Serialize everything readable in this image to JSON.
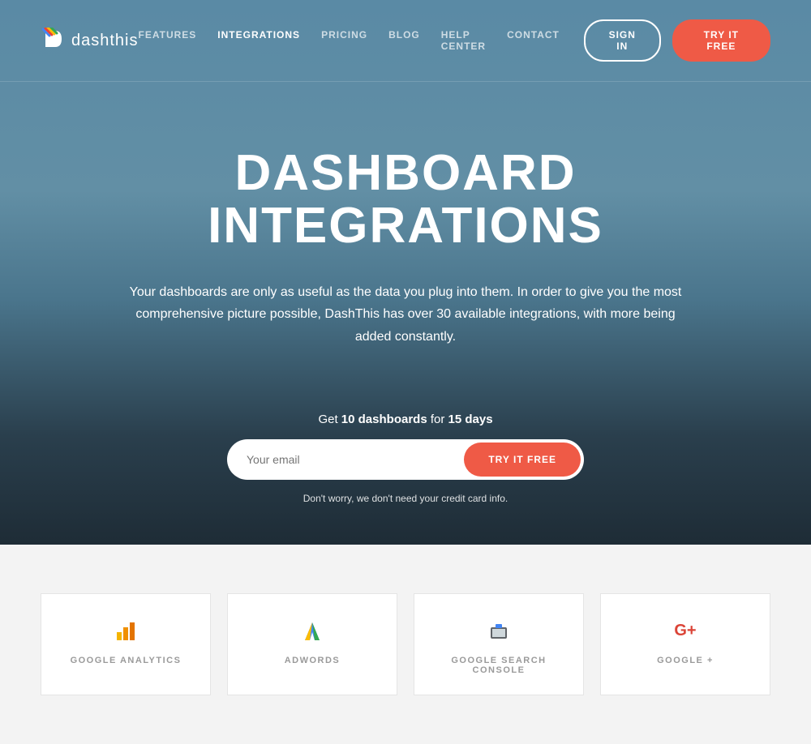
{
  "brand": {
    "name": "dashthis"
  },
  "nav": {
    "items": [
      {
        "label": "FEATURES",
        "active": false
      },
      {
        "label": "INTEGRATIONS",
        "active": true
      },
      {
        "label": "PRICING",
        "active": false
      },
      {
        "label": "BLOG",
        "active": false
      },
      {
        "label": "HELP CENTER",
        "active": false
      },
      {
        "label": "CONTACT",
        "active": false
      }
    ]
  },
  "header": {
    "signin_label": "SIGN IN",
    "try_label": "TRY IT FREE"
  },
  "hero": {
    "title_line1": "DASHBOARD",
    "title_line2": "INTEGRATIONS",
    "description": "Your dashboards are only as useful as the data you plug into them. In order to give you the most comprehensive picture possible, DashThis has over 30 available integrations, with more being added constantly."
  },
  "cta": {
    "tag_prefix": "Get ",
    "tag_bold1": "10 dashboards",
    "tag_mid": " for ",
    "tag_bold2": "15 days",
    "email_placeholder": "Your email",
    "button_label": "TRY IT FREE",
    "note": "Don't worry, we don't need your credit card info."
  },
  "integrations": {
    "cards": [
      {
        "name": "GOOGLE ANALYTICS",
        "icon": "google-analytics-icon"
      },
      {
        "name": "ADWORDS",
        "icon": "adwords-icon"
      },
      {
        "name": "GOOGLE SEARCH CONSOLE",
        "icon": "search-console-icon"
      },
      {
        "name": "GOOGLE +",
        "icon": "google-plus-icon"
      }
    ]
  },
  "colors": {
    "accent": "#ef5a46"
  }
}
